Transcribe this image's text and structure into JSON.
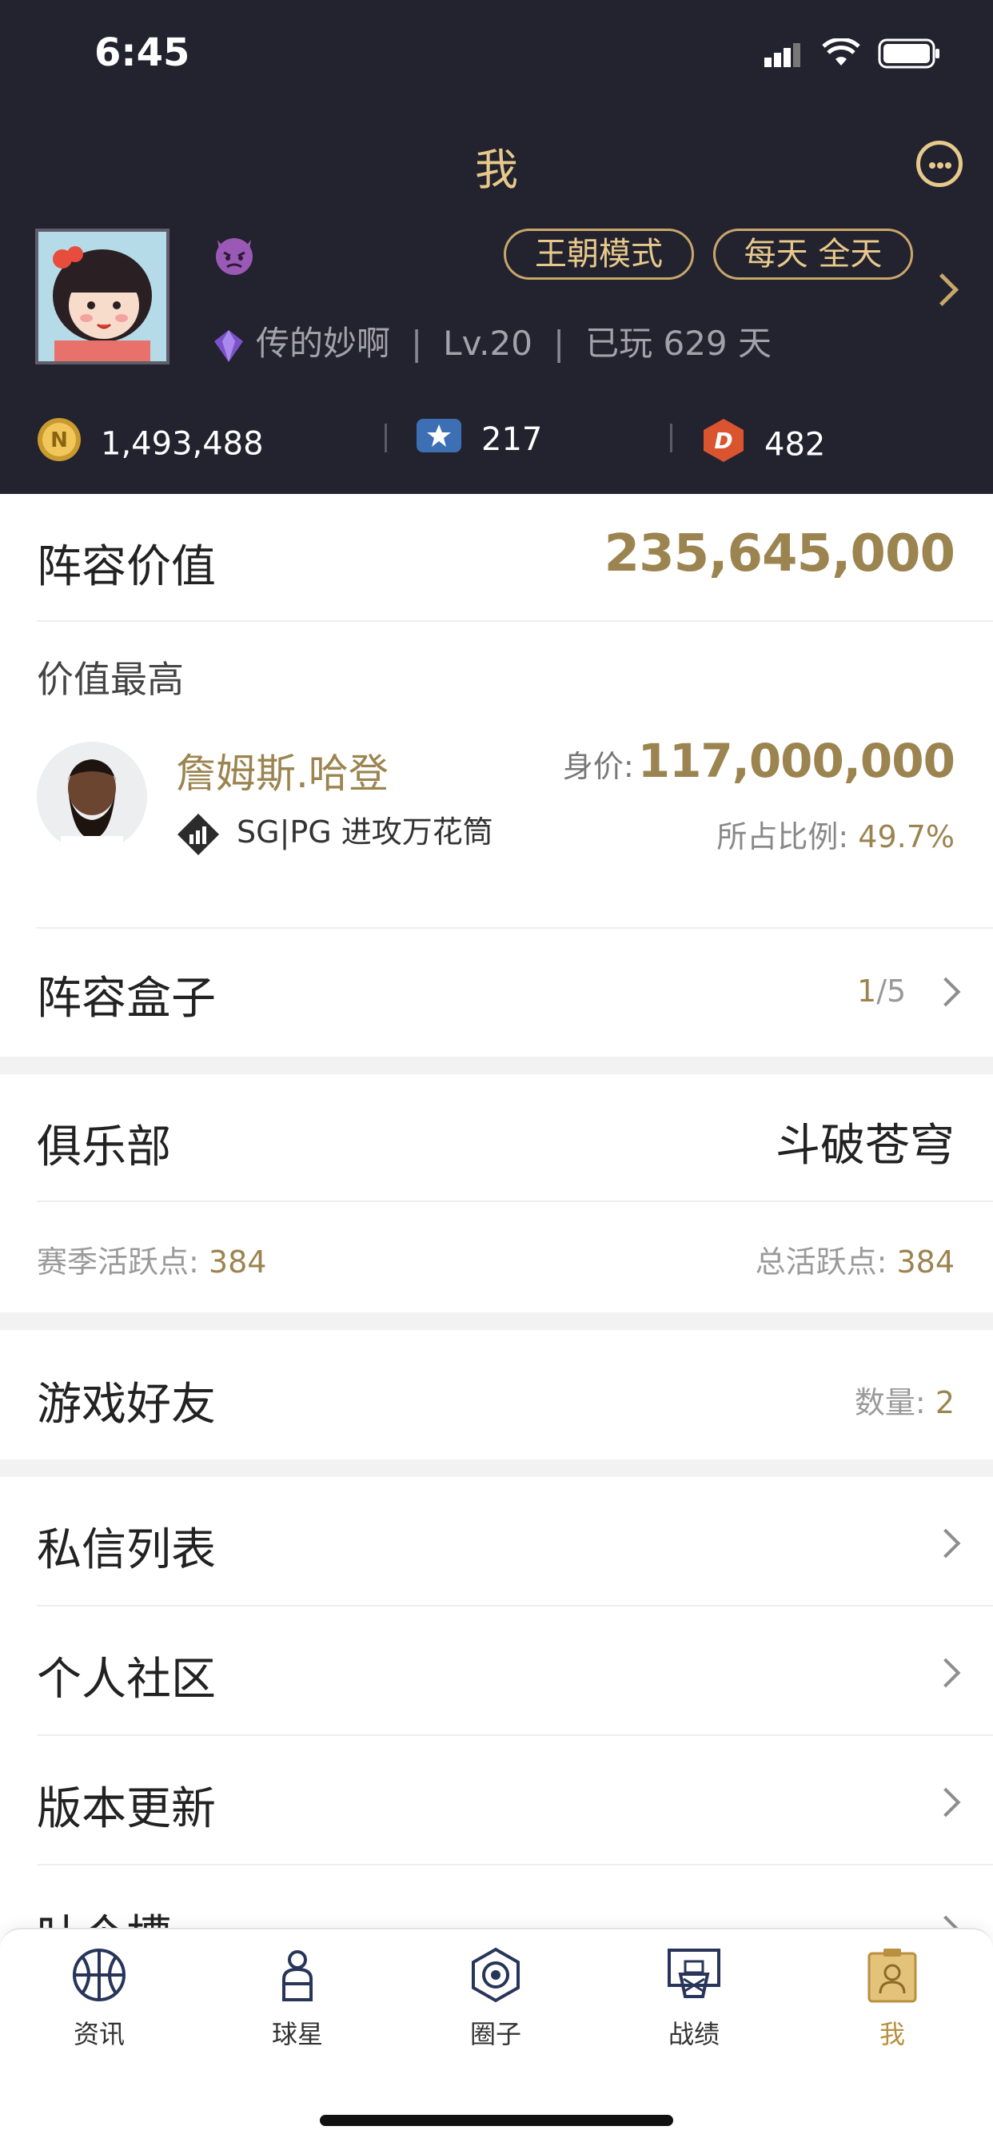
{
  "status_bar": {
    "time": "6:45"
  },
  "header": {
    "title": "我",
    "tags": [
      "王朝模式",
      "每天 全天"
    ],
    "username": "传的妙啊",
    "level": "Lv.20",
    "played": "已玩 629 天",
    "currencies": [
      {
        "icon": "n-coin-icon",
        "value": "1,493,488"
      },
      {
        "icon": "star-ticket-icon",
        "value": "217"
      },
      {
        "icon": "d-gem-icon",
        "value": "482"
      }
    ]
  },
  "lineup": {
    "label": "阵容价值",
    "value": "235,645,000",
    "top_label": "价值最高",
    "player_name": "詹姆斯.哈登",
    "player_pos": "SG|PG 进攻万花筒",
    "price_label": "身价:",
    "price": "117,000,000",
    "ratio_label": "所占比例:",
    "ratio": "49.7%",
    "box_label": "阵容盒子",
    "box_current": "1",
    "box_total": "/5"
  },
  "club": {
    "label": "俱乐部",
    "name": "斗破苍穹",
    "season_label": "赛季活跃点:",
    "season_value": "384",
    "total_label": "总活跃点:",
    "total_value": "384"
  },
  "friends": {
    "label": "游戏好友",
    "count_label": "数量:",
    "count": "2"
  },
  "menu": [
    "私信列表",
    "个人社区",
    "版本更新",
    "吐个槽"
  ],
  "tabs": [
    {
      "label": "资讯",
      "icon": "basketball-icon",
      "active": false
    },
    {
      "label": "球星",
      "icon": "player-icon",
      "active": false
    },
    {
      "label": "圈子",
      "icon": "circle-icon",
      "active": false
    },
    {
      "label": "战绩",
      "icon": "hoop-icon",
      "active": false
    },
    {
      "label": "我",
      "icon": "profile-card-icon",
      "active": true
    }
  ],
  "colors": {
    "header_bg": "#23222f",
    "gold": "#9c8450",
    "gold_light": "#e7c98b"
  }
}
